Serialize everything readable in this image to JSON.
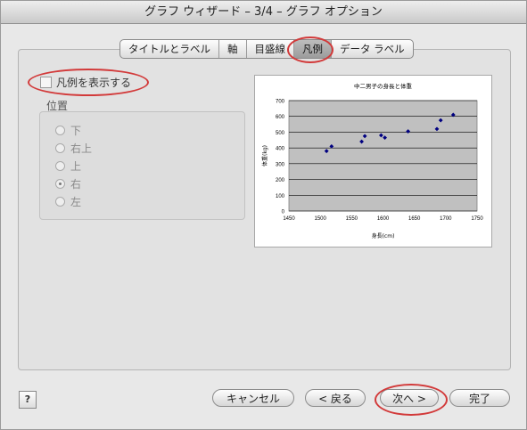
{
  "window": {
    "title": "グラフ ウィザード – 3/4 – グラフ オプション"
  },
  "tabs": [
    {
      "label": "タイトルとラベル",
      "active": false
    },
    {
      "label": "軸",
      "active": false
    },
    {
      "label": "目盛線",
      "active": false
    },
    {
      "label": "凡例",
      "active": true
    },
    {
      "label": "データ ラベル",
      "active": false
    }
  ],
  "legend": {
    "show_label": "凡例を表示する",
    "show_checked": false,
    "position_label": "位置",
    "positions": [
      {
        "label": "下",
        "selected": false
      },
      {
        "label": "右上",
        "selected": false
      },
      {
        "label": "上",
        "selected": false
      },
      {
        "label": "右",
        "selected": true
      },
      {
        "label": "左",
        "selected": false
      }
    ]
  },
  "chart_data": {
    "type": "scatter",
    "title": "中二男子の身長と体重",
    "xlabel": "身長(cm)",
    "ylabel": "体重(kg)",
    "xlim": [
      1450,
      1750
    ],
    "ylim": [
      0,
      700
    ],
    "x_ticks": [
      "1450",
      "1500",
      "1550",
      "1600",
      "1650",
      "1700",
      "1750"
    ],
    "y_ticks": [
      "0",
      "100",
      "200",
      "300",
      "400",
      "500",
      "600",
      "700"
    ],
    "grid": true,
    "plot_background": "#c0c0c0",
    "marker_color": "#000080",
    "points": [
      {
        "x": 1510,
        "y": 380
      },
      {
        "x": 1518,
        "y": 410
      },
      {
        "x": 1566,
        "y": 440
      },
      {
        "x": 1571,
        "y": 475
      },
      {
        "x": 1597,
        "y": 480
      },
      {
        "x": 1603,
        "y": 465
      },
      {
        "x": 1640,
        "y": 505
      },
      {
        "x": 1686,
        "y": 520
      },
      {
        "x": 1692,
        "y": 575
      },
      {
        "x": 1712,
        "y": 610
      }
    ]
  },
  "buttons": {
    "help": "?",
    "cancel": "キャンセル",
    "back": "< 戻る",
    "next": "次へ >",
    "finish": "完了"
  },
  "highlight_color": "#d23a3a"
}
